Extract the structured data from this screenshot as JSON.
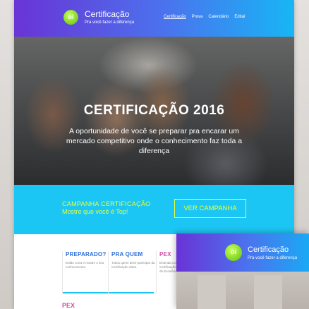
{
  "header": {
    "logo_text": "oi",
    "title": "Certificação",
    "subtitle": "Pra você fazer a diferença",
    "nav": [
      {
        "label": "Certificação"
      },
      {
        "label": "Prova"
      },
      {
        "label": "Calendário"
      },
      {
        "label": "Edital"
      }
    ]
  },
  "hero": {
    "title": "CERTIFICAÇÃO 2016",
    "text": "A oportunidade de você se preparar pra encarar um mercado competitivo onde o conhecimento faz toda a diferença"
  },
  "campaign": {
    "title": "CAMPANHA CERTIFICAÇÃO",
    "subtitle": "Mostre que você é Top!",
    "button": "VER CAMPANHA"
  },
  "cards": [
    {
      "title": "PREPARADO?",
      "text": "Então corra e mostre o seu conhecimento.",
      "color": "#2a6fd6"
    },
    {
      "title": "PRA QUEM",
      "text": "Todos quem deve participar da Certificação 2016.",
      "color": "#2a6fd6"
    },
    {
      "title": "PEX",
      "text": "Entenda como funciona a Certificação 2016 Programa de Excelência.",
      "color": "#d64aa8"
    }
  ],
  "cards_bottom": {
    "title": "PEX"
  },
  "overlay": {
    "logo_text": "oi",
    "title": "Certificação",
    "subtitle": "Pra você fazer a diferença"
  },
  "colors": {
    "accent_cyan": "#1cc6f4",
    "accent_lime": "#e6ff3a",
    "brand_purple": "#6a33d6",
    "brand_green": "#7dd321"
  }
}
